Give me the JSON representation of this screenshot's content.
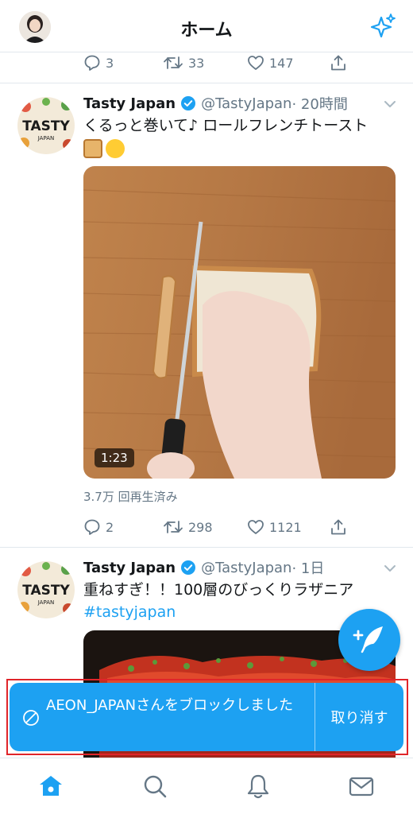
{
  "header": {
    "title": "ホーム"
  },
  "prev_tweet": {
    "replies": "3",
    "retweets": "33",
    "likes": "147"
  },
  "tweets": [
    {
      "name": "Tasty Japan",
      "handle": "@TastyJapan",
      "time": "· 20時間",
      "text": "くるっと巻いて♪ ロールフレンチトースト",
      "duration": "1:23",
      "views": "3.7万 回再生済み",
      "replies": "2",
      "retweets": "298",
      "likes": "1121"
    },
    {
      "name": "Tasty Japan",
      "handle": "@TastyJapan",
      "time": "· 1日",
      "text": "重ねすぎ！！100層のびっくりラザニア",
      "hashtag": "#tastyjapan"
    }
  ],
  "toast": {
    "message": "AEON_JAPANさんをブロックしました",
    "undo_label": "取り消す"
  },
  "colors": {
    "accent": "#1da1f2",
    "muted": "#657786",
    "highlight_border": "#e0252a"
  },
  "icons": [
    "sparkle-icon",
    "reply-icon",
    "retweet-icon",
    "like-icon",
    "share-icon",
    "verified-icon",
    "chevron-down-icon",
    "compose-icon",
    "block-icon",
    "home-icon",
    "search-icon",
    "notifications-icon",
    "messages-icon"
  ]
}
